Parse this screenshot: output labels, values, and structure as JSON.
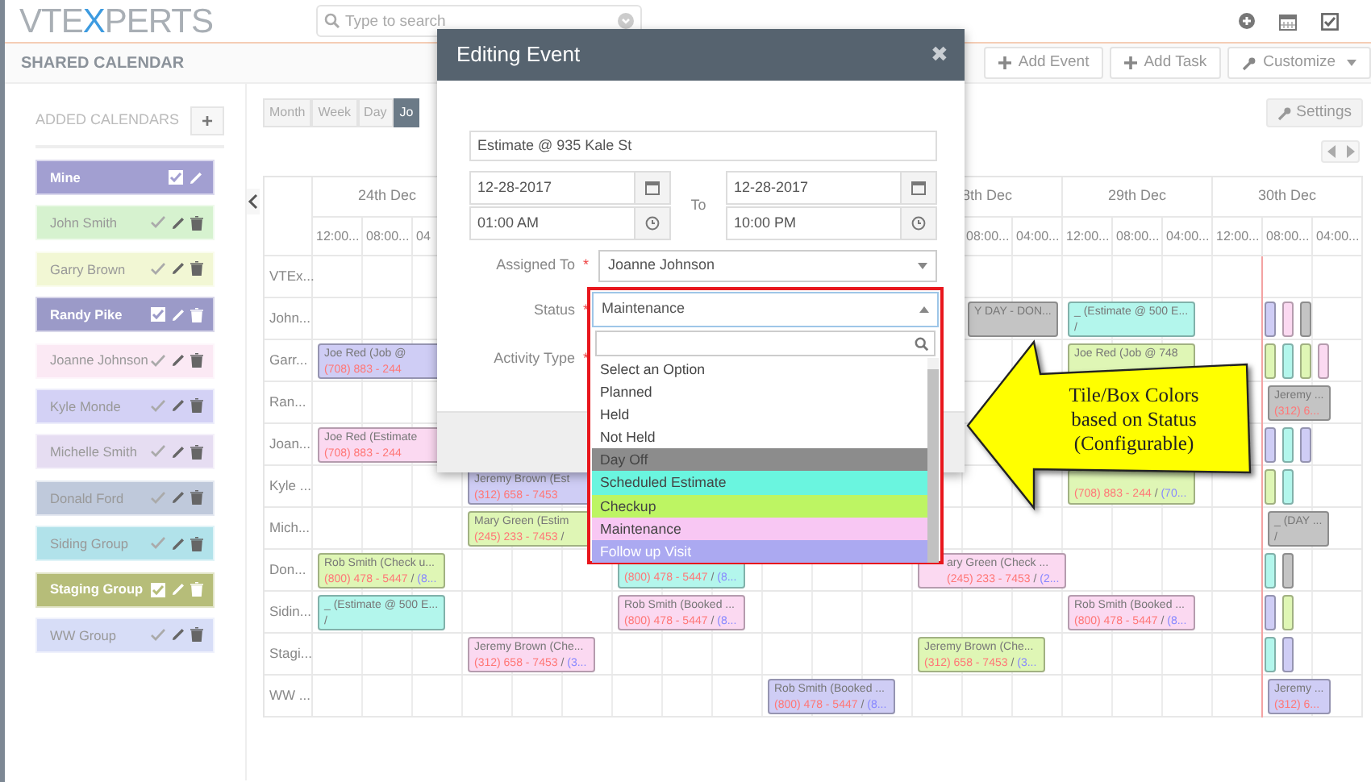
{
  "topbar": {
    "logo": {
      "before": "VTE",
      "accent": "X",
      "after": "PERTS"
    },
    "search": {
      "placeholder": "Type to search"
    }
  },
  "header": {
    "title": "SHARED CALENDAR",
    "buttons": [
      {
        "kind": "plus",
        "label": "Add Event"
      },
      {
        "kind": "plus",
        "label": "Add Task"
      },
      {
        "kind": "wrench",
        "label": "Customize"
      }
    ]
  },
  "sidebar": {
    "title": "ADDED CALENDARS",
    "add_label": "+",
    "items": [
      {
        "name": "Mine",
        "color": "#a29fd1",
        "checked": true,
        "deletable": false
      },
      {
        "name": "John Smith",
        "color": "#d6f2cf",
        "checked": true,
        "deletable": true
      },
      {
        "name": "Garry Brown",
        "color": "#f2f7d4",
        "checked": true,
        "deletable": true
      },
      {
        "name": "Randy Pike",
        "color": "#9b9ac8",
        "checked": true,
        "deletable": true
      },
      {
        "name": "Joanne Johnson",
        "color": "#fbe9f4",
        "checked": true,
        "deletable": true
      },
      {
        "name": "Kyle Monde",
        "color": "#d3d1f5",
        "checked": true,
        "deletable": true
      },
      {
        "name": "Michelle Smith",
        "color": "#e6ddf2",
        "checked": true,
        "deletable": true
      },
      {
        "name": "Donald Ford",
        "color": "#bfc9db",
        "checked": true,
        "deletable": true
      },
      {
        "name": "Siding Group",
        "color": "#b1e2ea",
        "checked": true,
        "deletable": true
      },
      {
        "name": "Staging Group",
        "color": "#b6bd79",
        "checked": true,
        "deletable": true
      },
      {
        "name": "WW Group",
        "color": "#d7ddf7",
        "checked": true,
        "deletable": true
      }
    ]
  },
  "views": [
    {
      "label": "Month",
      "selected": false
    },
    {
      "label": "Week",
      "selected": false
    },
    {
      "label": "Day",
      "selected": false
    },
    {
      "label": "Jo",
      "selected": true
    }
  ],
  "settings_label": "Settings",
  "timeline": {
    "day_headers": [
      {
        "label": "24th Dec"
      },
      {
        "label": "8th Dec"
      },
      {
        "label": "29th Dec"
      },
      {
        "label": "30th Dec"
      }
    ],
    "slot_headers": [
      {
        "label": "12:00..."
      },
      {
        "label": "08:00..."
      },
      {
        "label": "04"
      },
      {
        "label": "08:00..."
      },
      {
        "label": "04:00..."
      },
      {
        "label": "12:00..."
      },
      {
        "label": "08:00..."
      },
      {
        "label": "04:00..."
      },
      {
        "label": "12:00..."
      },
      {
        "label": "08:00..."
      },
      {
        "label": "04:00..."
      }
    ],
    "rows": [
      {
        "label": "VTEx...",
        "events": [],
        "strips": []
      },
      {
        "label": "John...",
        "events": [
          {
            "kind": "medium",
            "color": "#c4c4c4",
            "subject": "Y DAY - DON..."
          },
          {
            "kind": "full",
            "color": "#b3f6ec",
            "subject": "_ (Estimate @ 500 E...",
            "phone": "/"
          }
        ],
        "strips": [
          {
            "color": "#cfcdf5"
          },
          {
            "color": "#fbd9f1"
          },
          {
            "color": "#c4c4c4"
          }
        ]
      },
      {
        "label": "Garr...",
        "events": [
          {
            "kind": "full",
            "color": "#cfcdf5",
            "contact": "Joe Red",
            "subject": "(Job @",
            "phone": "(708) 883 - 244"
          },
          {
            "kind": "full",
            "color": "#dff6b5",
            "contact": "Joe Red",
            "subject": "(Job @ 748"
          }
        ],
        "strips": [
          {
            "color": "#dff6b5"
          },
          {
            "color": "#b3f6ec"
          },
          {
            "color": "#dff6b5"
          },
          {
            "color": "#fbd9f1"
          }
        ]
      },
      {
        "label": "Ran...",
        "events": [
          {
            "kind": "short",
            "color": "#c4c4c4",
            "contact": "Jeremy ...",
            "phone": "(312) 6..."
          }
        ],
        "strips": []
      },
      {
        "label": "Joan...",
        "events": [
          {
            "kind": "full",
            "color": "#fbd9f1",
            "contact": "Joe Red",
            "subject": "(Estimate",
            "phone": "(708) 883 - 244"
          }
        ],
        "strips": [
          {
            "color": "#cfcdf5"
          },
          {
            "color": "#b3f6ec"
          },
          {
            "color": "#cfcdf5"
          }
        ]
      },
      {
        "label": "Kyle ...",
        "events": [
          {
            "kind": "full",
            "color": "#cfcdf5",
            "contact": "Jeremy Brown",
            "subject": "(Est",
            "phone": "(312) 658 - 7453"
          },
          {
            "kind": "full",
            "color": "#dff6b5",
            "phone": "(708) 883 - 244",
            "separator": "/",
            "phone2": "(70..."
          }
        ],
        "strips": [
          {
            "color": "#dff6b5"
          },
          {
            "color": "#b3f6ec"
          }
        ]
      },
      {
        "label": "Mich...",
        "events": [
          {
            "kind": "full",
            "color": "#dff6b5",
            "contact": "Mary Green",
            "subject": "(Estim",
            "phone": "(245) 233 - 7453",
            "separator": "/"
          },
          {
            "kind": "short",
            "color": "#c4c4c4",
            "subject": "_ (DAY ...",
            "phone": "/"
          }
        ],
        "strips": []
      },
      {
        "label": "Don...",
        "events": [
          {
            "kind": "full",
            "color": "#dff6b5",
            "contact": "Rob Smith",
            "subject": "(Check u...",
            "phone": "(800) 478 - 5447",
            "separator": "/",
            "phone2": "(8..."
          },
          {
            "kind": "full",
            "color": "#b3f6ec",
            "phone": "(800) 478 - 5447",
            "separator": "/",
            "phone2": "(8..."
          },
          {
            "kind": "full",
            "color": "#fbd9f1",
            "contact": "ary Green",
            "subject": "(Check ...",
            "phone": "(245) 233 - 7453",
            "separator": "/",
            "phone2": "(2..."
          }
        ],
        "strips": [
          {
            "color": "#b3f6ec"
          },
          {
            "color": "#c4c4c4"
          }
        ]
      },
      {
        "label": "Sidin...",
        "events": [
          {
            "kind": "full",
            "color": "#b3f6ec",
            "subject": "_ (Estimate @ 500 E...",
            "phone": "/"
          },
          {
            "kind": "full",
            "color": "#fbd9f1",
            "contact": "Rob Smith",
            "subject": "(Booked ...",
            "phone": "(800) 478 - 5447",
            "separator": "/",
            "phone2": "(8..."
          },
          {
            "kind": "full",
            "color": "#fbd9f1",
            "contact": "Rob Smith",
            "subject": "(Booked ...",
            "phone": "(800) 478 - 5447",
            "separator": "/",
            "phone2": "(8..."
          }
        ],
        "strips": [
          {
            "color": "#cfcdf5"
          },
          {
            "color": "#dff6b5"
          }
        ]
      },
      {
        "label": "Stagi...",
        "events": [
          {
            "kind": "full",
            "color": "#fbd9f1",
            "contact": "Jeremy Brown",
            "subject": "(Che...",
            "phone": "(312) 658 - 7453",
            "separator": "/",
            "phone2": "(3..."
          },
          {
            "kind": "full",
            "color": "#dff6b5",
            "contact": "Jeremy Brown",
            "subject": "(Che...",
            "phone": "(312) 658 - 7453",
            "separator": "/",
            "phone2": "(3..."
          }
        ],
        "strips": [
          {
            "color": "#b3f6ec"
          },
          {
            "color": "#cfcdf5"
          }
        ]
      },
      {
        "label": "WW ...",
        "events": [
          {
            "kind": "full",
            "color": "#cfcdf5",
            "contact": "Rob Smith",
            "subject": "(Booked ...",
            "phone": "(800) 478 - 5447",
            "separator": "/",
            "phone2": "(8..."
          },
          {
            "kind": "short",
            "color": "#cfcdf5",
            "contact": "Jeremy ...",
            "phone": "(312) 6..."
          }
        ],
        "strips": []
      }
    ]
  },
  "modal": {
    "title": "Editing Event",
    "close": "✖",
    "subject": "Estimate @ 935 Kale St",
    "start_date": "12-28-2017",
    "start_time": "01:00 AM",
    "to_label": "To",
    "end_date": "12-28-2017",
    "end_time": "10:00 PM",
    "required_mark": "*",
    "fields": [
      {
        "label": "Assigned To",
        "required": true,
        "value": "Joanne Johnson"
      },
      {
        "label": "Status",
        "required": true
      },
      {
        "label": "Activity Type",
        "required": true
      }
    ]
  },
  "status_dropdown": {
    "value": "Maintenance",
    "options": [
      {
        "label": "Select an Option"
      },
      {
        "label": "Planned"
      },
      {
        "label": "Held"
      },
      {
        "label": "Not Held"
      },
      {
        "label": "Day Off",
        "color": "#8c8c8c"
      },
      {
        "label": "Scheduled Estimate",
        "color": "#6af5df"
      },
      {
        "label": "Checkup",
        "color": "#bdf563"
      },
      {
        "label": "Maintenance",
        "color": "#f8c7f3"
      },
      {
        "label": "Follow up Visit",
        "color": "#aba9f1"
      }
    ]
  },
  "callout": {
    "lines": [
      "Tile/Box Colors",
      "based on Status",
      "(Configurable)"
    ]
  }
}
